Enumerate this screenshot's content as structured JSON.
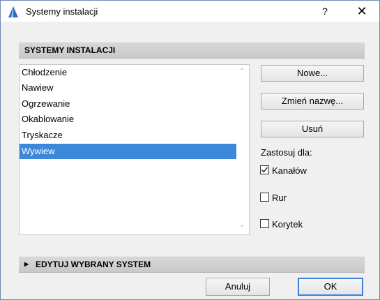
{
  "window": {
    "title": "Systemy instalacji",
    "help_label": "?",
    "close_label": "✕"
  },
  "section1": {
    "title": "SYSTEMY INSTALACJI"
  },
  "list": {
    "items": [
      "Chłodzenie",
      "Nawiew",
      "Ogrzewanie",
      "Okablowanie",
      "Tryskacze",
      "Wywiew"
    ],
    "selected_index": 5
  },
  "actions": {
    "new_label": "Nowe...",
    "rename_label": "Zmień nazwę...",
    "delete_label": "Usuń"
  },
  "apply": {
    "label": "Zastosuj dla:",
    "options": [
      {
        "label": "Kanałów",
        "checked": true
      },
      {
        "label": "Rur",
        "checked": false
      },
      {
        "label": "Korytek",
        "checked": false
      }
    ]
  },
  "section2": {
    "title": "EDYTUJ WYBRANY SYSTEM"
  },
  "footer": {
    "cancel_label": "Anuluj",
    "ok_label": "OK"
  },
  "colors": {
    "selection": "#3b87d9",
    "accent": "#3b7fd9"
  }
}
